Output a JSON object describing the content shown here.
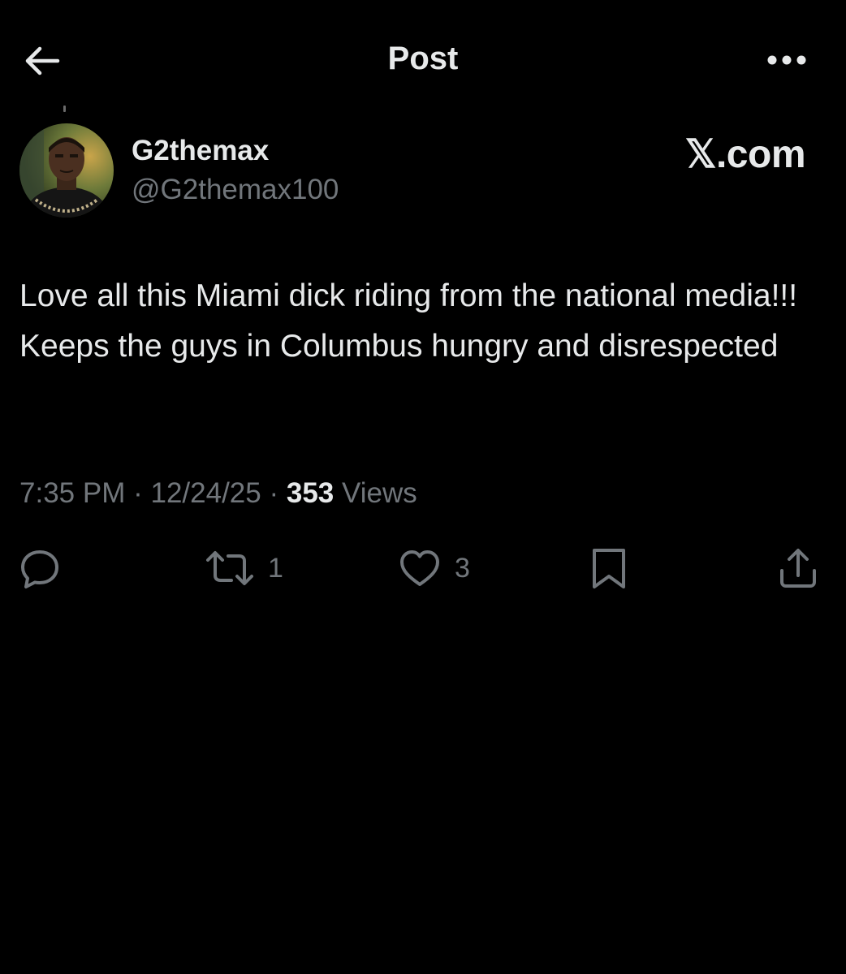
{
  "header": {
    "title": "Post",
    "back_icon": "arrow-left-icon",
    "more_icon": "ellipsis-icon"
  },
  "post": {
    "display_name": "G2themax",
    "handle": "@G2themax100",
    "watermark": "𝕏.com",
    "text": "Love all this Miami dick riding from the national media!!! Keeps the guys in Columbus hungry and disrespected",
    "time": "7:35 PM",
    "separator": "·",
    "date": "12/24/25",
    "views_count": "353",
    "views_label": "Views"
  },
  "actions": {
    "reply_icon": "reply-icon",
    "repost_icon": "repost-icon",
    "repost_count": "1",
    "like_icon": "heart-icon",
    "like_count": "3",
    "bookmark_icon": "bookmark-icon",
    "share_icon": "share-icon"
  },
  "colors": {
    "background": "#000000",
    "text_primary": "#e7e9ea",
    "text_secondary": "#71767b"
  }
}
